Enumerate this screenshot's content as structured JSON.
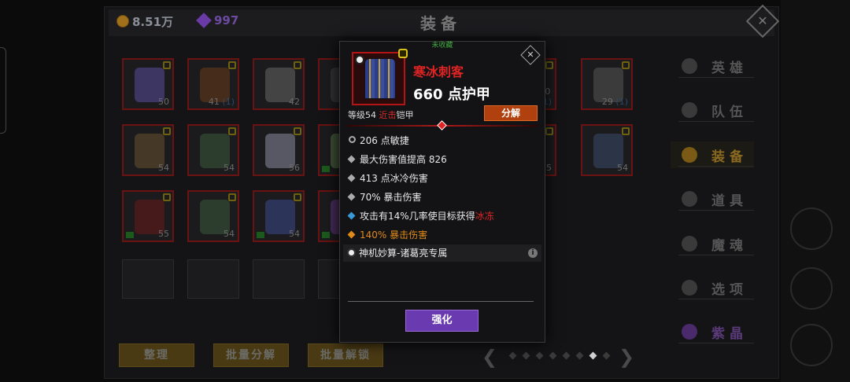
{
  "currency": {
    "gold": "8.51万",
    "gems": "997"
  },
  "title": "装备",
  "grid": [
    {
      "level": "50",
      "extra": ""
    },
    {
      "level": "41",
      "extra": "(1)"
    },
    {
      "level": "42",
      "extra": ""
    },
    {
      "level": "",
      "extra": ""
    },
    {
      "level": "30",
      "extra": "(1)"
    },
    {
      "level": "29",
      "extra": "(1)"
    },
    {
      "level": "54",
      "extra": ""
    },
    {
      "level": "54",
      "extra": ""
    },
    {
      "level": "56",
      "extra": ""
    },
    {
      "level": "",
      "extra": ""
    },
    {
      "level": "55",
      "extra": ""
    },
    {
      "level": "54",
      "extra": ""
    },
    {
      "level": "55",
      "extra": ""
    },
    {
      "level": "54",
      "extra": ""
    },
    {
      "level": "54",
      "extra": ""
    }
  ],
  "menu": [
    {
      "label": "英雄",
      "icon": "hero-icon"
    },
    {
      "label": "队伍",
      "icon": "flag-icon"
    },
    {
      "label": "装备",
      "icon": "helmet-icon"
    },
    {
      "label": "道具",
      "icon": "bag-icon"
    },
    {
      "label": "魔魂",
      "icon": "flame-icon"
    },
    {
      "label": "选项",
      "icon": "gear-icon"
    },
    {
      "label": "紫晶",
      "icon": "crystal-icon"
    }
  ],
  "bottom_buttons": {
    "sort": "整理",
    "batch_decompose": "批量分解",
    "batch_unlock": "批量解锁"
  },
  "pagination": {
    "prev": "❮",
    "next": "❯",
    "current_page": 7,
    "total_pages": 8
  },
  "popup": {
    "collect_status": "未收藏",
    "item_name": "寒冰刺客",
    "armor": "660 点护甲",
    "level_prefix": "等级54 ",
    "level_type": "近击",
    "level_suffix": "铠甲",
    "decompose": "分解",
    "stats": [
      "206 点敏捷",
      "最大伤害值提高 826",
      "413 点冰冷伤害",
      "70% 暴击伤害"
    ],
    "proc_prefix": "攻击有14%几率使目标获得",
    "proc_effect": "冰冻",
    "bonus_stat": "140% 暴击伤害",
    "set_name": "神机妙算-诸葛亮专属",
    "info_icon": "i",
    "enhance": "强化",
    "close_symbol": "✕"
  },
  "colors": {
    "accent_red": "#e02424",
    "legendary_orange": "#e08a1a",
    "purple": "#6a3ab0"
  }
}
